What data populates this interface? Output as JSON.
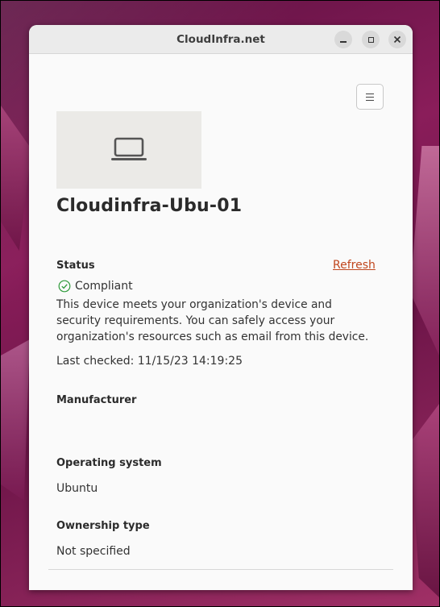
{
  "window": {
    "title": "CloudInfra.net"
  },
  "device": {
    "name": "Cloudinfra-Ubu-01",
    "thumbnail_icon": "laptop-icon"
  },
  "status": {
    "label": "Status",
    "refresh_label": "Refresh",
    "state": "Compliant",
    "description": "This device meets your organization's device and security requirements. You can safely access your organization's resources such as email from this device.",
    "last_checked": "Last checked: 11/15/23 14:19:25"
  },
  "manufacturer": {
    "label": "Manufacturer",
    "value": ""
  },
  "operating_system": {
    "label": "Operating system",
    "value": "Ubuntu"
  },
  "ownership": {
    "label": "Ownership type",
    "value": "Not specified"
  },
  "colors": {
    "link": "#c0461d",
    "success": "#2e9a3a",
    "titlebar": "#ebebeb",
    "window_bg": "#fafafa"
  }
}
